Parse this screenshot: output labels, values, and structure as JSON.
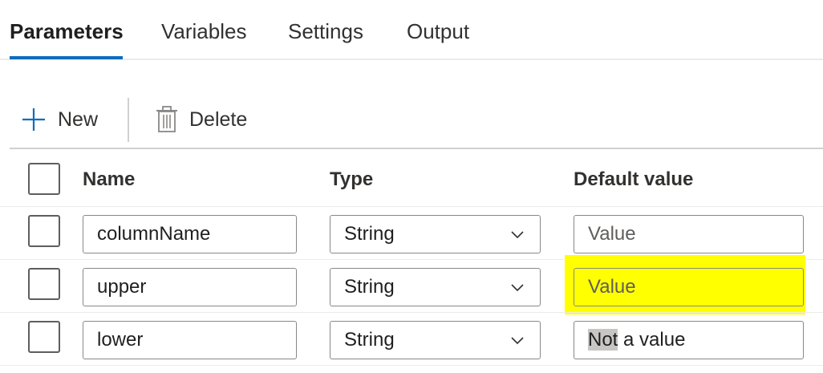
{
  "tabs": [
    {
      "label": "Parameters",
      "active": true
    },
    {
      "label": "Variables",
      "active": false
    },
    {
      "label": "Settings",
      "active": false
    },
    {
      "label": "Output",
      "active": false
    }
  ],
  "toolbar": {
    "new_label": "New",
    "delete_label": "Delete"
  },
  "columns": {
    "name": "Name",
    "type": "Type",
    "default_value": "Default value"
  },
  "rows": [
    {
      "name": "columnName",
      "type": "String",
      "default_placeholder": "Value",
      "default_value": ""
    },
    {
      "name": "upper",
      "type": "String",
      "default_placeholder": "Value",
      "default_value": ""
    },
    {
      "name": "lower",
      "type": "String",
      "default_placeholder": "",
      "default_value_selected": "Not",
      "default_value_rest": " a value"
    }
  ],
  "colors": {
    "accent": "#0f6cbd",
    "highlight": "#ffff00"
  },
  "icons": {
    "new": "plus-icon",
    "delete": "trash-icon",
    "dropdown": "chevron-down-icon"
  }
}
